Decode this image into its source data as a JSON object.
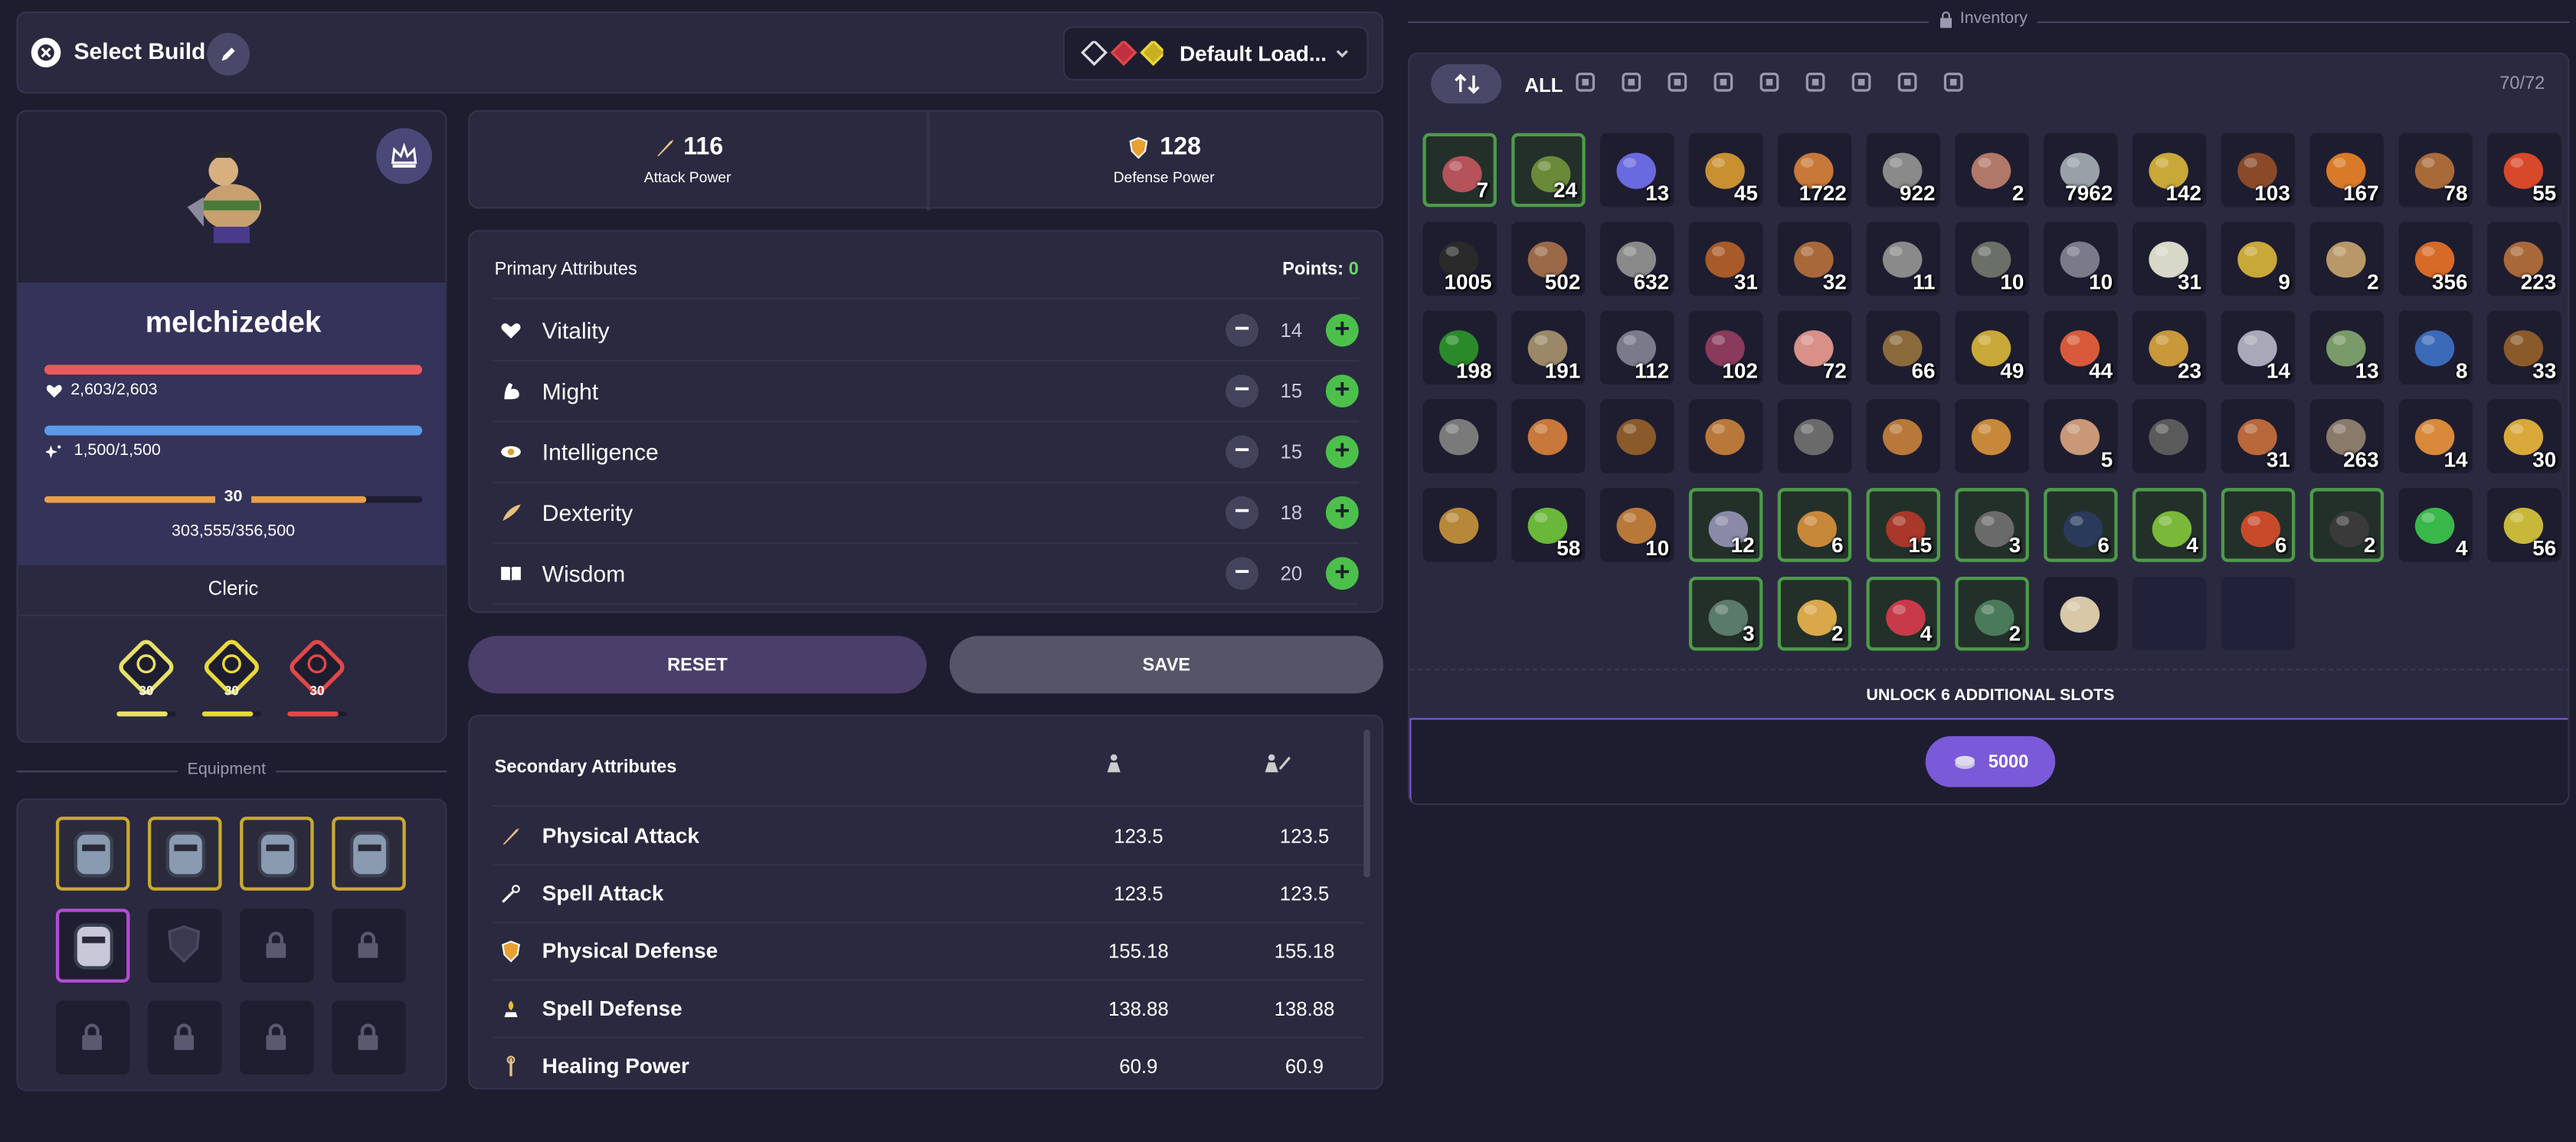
{
  "header": {
    "title": "Select Build",
    "loadout": "Default Load..."
  },
  "power": {
    "attack_value": "116",
    "attack_label": "Attack Power",
    "defense_value": "128",
    "defense_label": "Defense Power"
  },
  "character": {
    "name": "melchizedek",
    "hp": "2,603/2,603",
    "hp_fraction": 1.0,
    "mana": "1,500/1,500",
    "mana_fraction": 1.0,
    "level": "30",
    "xp": "303,555/356,500",
    "xp_fraction": 0.85,
    "class": "Cleric",
    "professions": [
      {
        "level": "30",
        "color": "#e8e06a",
        "fraction": 0.85
      },
      {
        "level": "30",
        "color": "#e8d83a",
        "fraction": 0.85
      },
      {
        "level": "30",
        "color": "#e04848",
        "fraction": 0.85
      }
    ]
  },
  "equipment": {
    "title": "Equipment"
  },
  "primary": {
    "title": "Primary Attributes",
    "points_label": "Points:",
    "points_value": "0",
    "items": [
      {
        "name": "Vitality",
        "value": "14",
        "icon": "heart-icon"
      },
      {
        "name": "Might",
        "value": "15",
        "icon": "flexed-arm-icon"
      },
      {
        "name": "Intelligence",
        "value": "15",
        "icon": "eye-icon"
      },
      {
        "name": "Dexterity",
        "value": "18",
        "icon": "feather-icon"
      },
      {
        "name": "Wisdom",
        "value": "20",
        "icon": "book-icon"
      }
    ]
  },
  "buttons": {
    "reset": "RESET",
    "save": "SAVE"
  },
  "secondary": {
    "title": "Secondary Attributes",
    "items": [
      {
        "name": "Physical Attack",
        "a": "123.5",
        "b": "123.5",
        "icon": "sword-icon"
      },
      {
        "name": "Spell Attack",
        "a": "123.5",
        "b": "123.5",
        "icon": "wand-icon"
      },
      {
        "name": "Physical Defense",
        "a": "155.18",
        "b": "155.18",
        "icon": "shield-icon"
      },
      {
        "name": "Spell Defense",
        "a": "138.88",
        "b": "138.88",
        "icon": "magic-shield-icon"
      },
      {
        "name": "Healing Power",
        "a": "60.9",
        "b": "60.9",
        "icon": "staff-icon"
      }
    ]
  },
  "inventory": {
    "title": "Inventory",
    "filter_all": "ALL",
    "count": "70/72",
    "unlock_text": "UNLOCK 6 ADDITIONAL SLOTS",
    "unlock_cost": "5000",
    "items": [
      {
        "c": "7",
        "g": true,
        "col": "#b5525a"
      },
      {
        "c": "24",
        "g": true,
        "col": "#6a8a3a"
      },
      {
        "c": "13",
        "col": "#6a6ae0"
      },
      {
        "c": "45",
        "col": "#c89030"
      },
      {
        "c": "1722",
        "col": "#c87838"
      },
      {
        "c": "922",
        "col": "#8a8a8a"
      },
      {
        "c": "2",
        "col": "#b07868"
      },
      {
        "c": "7962",
        "col": "#9aa0a8"
      },
      {
        "c": "142",
        "col": "#c8a838"
      },
      {
        "c": "103",
        "col": "#8a4a2a"
      },
      {
        "c": "167",
        "col": "#d87a28"
      },
      {
        "c": "78",
        "col": "#a86a38"
      },
      {
        "c": "55",
        "col": "#d8482a"
      },
      {
        "c": "1005",
        "col": "#2a2a2a"
      },
      {
        "c": "502",
        "col": "#9a6a48"
      },
      {
        "c": "632",
        "col": "#8a8a8a"
      },
      {
        "c": "31",
        "col": "#a85a28"
      },
      {
        "c": "32",
        "col": "#a8683a"
      },
      {
        "c": "11",
        "col": "#8a8a8a"
      },
      {
        "c": "10",
        "col": "#6a7068"
      },
      {
        "c": "10",
        "col": "#7a7a8a"
      },
      {
        "c": "31",
        "col": "#d8d8c8"
      },
      {
        "c": "9",
        "col": "#c8a838"
      },
      {
        "c": "2",
        "col": "#b89868"
      },
      {
        "c": "356",
        "col": "#d86a28"
      },
      {
        "c": "223",
        "col": "#a8683a"
      },
      {
        "c": "198",
        "col": "#2a8a2a"
      },
      {
        "c": "191",
        "col": "#9a8868"
      },
      {
        "c": "112",
        "col": "#7a7a8a"
      },
      {
        "c": "102",
        "col": "#8a3a5a"
      },
      {
        "c": "72",
        "col": "#d89088"
      },
      {
        "c": "66",
        "col": "#8a6a3a"
      },
      {
        "c": "49",
        "col": "#c8a838"
      },
      {
        "c": "44",
        "col": "#d85a3a"
      },
      {
        "c": "23",
        "col": "#c8983a"
      },
      {
        "c": "14",
        "col": "#a8a8b8"
      },
      {
        "c": "13",
        "col": "#7a9a6a"
      },
      {
        "c": "8",
        "col": "#3a6ab8"
      },
      {
        "c": "33",
        "col": "#8a5a2a"
      },
      {
        "c": "",
        "col": "#7a7a7a"
      },
      {
        "c": "",
        "col": "#c8783a"
      },
      {
        "c": "",
        "col": "#8a5a2a"
      },
      {
        "c": "",
        "col": "#b8783a"
      },
      {
        "c": "",
        "col": "#6a6a6a"
      },
      {
        "c": "",
        "col": "#b8783a"
      },
      {
        "c": "",
        "col": "#c8883a"
      },
      {
        "c": "5",
        "col": "#c89878"
      },
      {
        "c": "",
        "col": "#5a5a5a"
      },
      {
        "c": "31",
        "col": "#b8683a"
      },
      {
        "c": "263",
        "col": "#8a7a6a"
      },
      {
        "c": "14",
        "col": "#d88a3a"
      },
      {
        "c": "30",
        "col": "#d8a83a"
      },
      {
        "c": "",
        "col": "#b8883a"
      },
      {
        "c": "58",
        "col": "#6ab83a"
      },
      {
        "c": "10",
        "col": "#b87838"
      },
      {
        "c": "12",
        "g": true,
        "col": "#8a8aa8"
      },
      {
        "c": "6",
        "g": true,
        "col": "#c8883a"
      },
      {
        "c": "15",
        "g": true,
        "col": "#a8382a"
      },
      {
        "c": "3",
        "g": true,
        "col": "#6a6a6a"
      },
      {
        "c": "6",
        "g": true,
        "col": "#2a3a5a"
      },
      {
        "c": "4",
        "g": true,
        "col": "#7ab83a"
      },
      {
        "c": "6",
        "g": true,
        "col": "#c84a2a"
      },
      {
        "c": "2",
        "g": true,
        "col": "#3a3a3a"
      },
      {
        "c": "4",
        "col": "#3ab84a"
      },
      {
        "c": "56",
        "col": "#c8b83a"
      }
    ],
    "last_row": [
      {
        "c": "3",
        "g": true,
        "col": "#5a7a6a"
      },
      {
        "c": "2",
        "g": true,
        "col": "#d8a84a"
      },
      {
        "c": "4",
        "g": true,
        "col": "#c83a4a"
      },
      {
        "c": "2",
        "g": true,
        "col": "#4a7a5a"
      },
      {
        "c": "",
        "col": "#d8c8a8"
      },
      {
        "c": "",
        "empty": true
      },
      {
        "c": "",
        "empty": true
      }
    ]
  }
}
